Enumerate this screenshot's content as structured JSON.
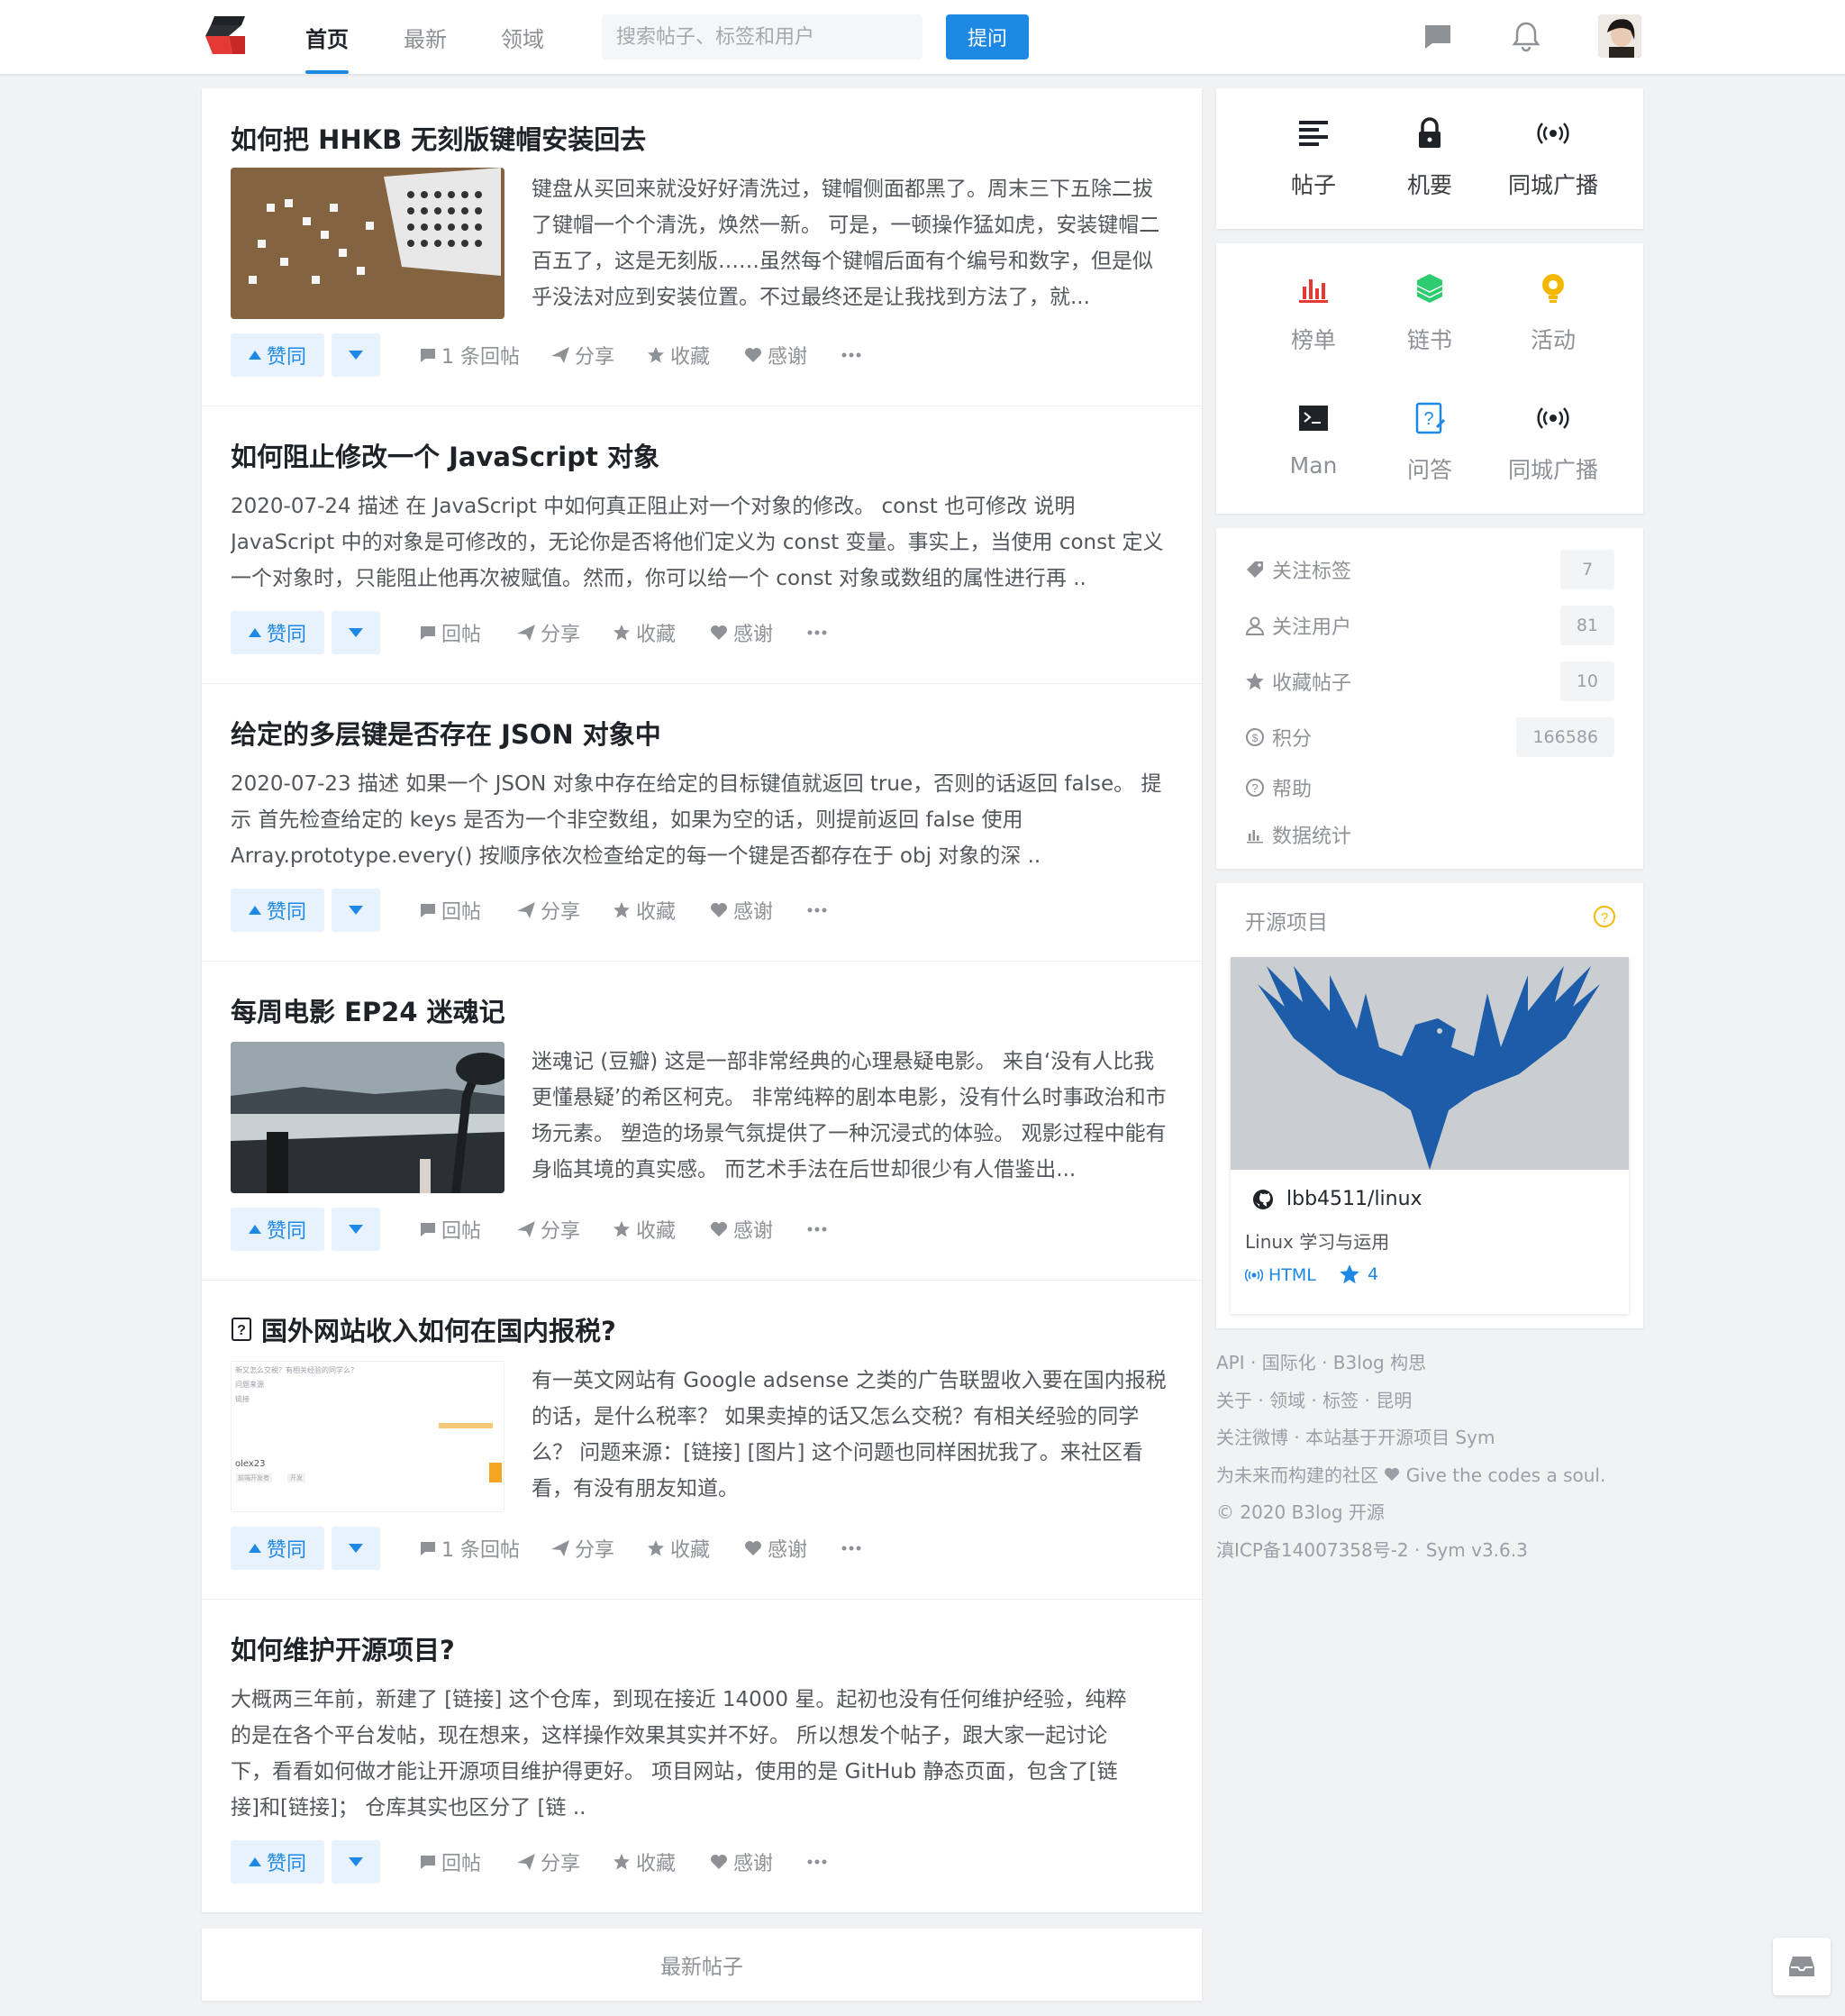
{
  "header": {
    "nav": [
      "首页",
      "最新",
      "领域"
    ],
    "search_placeholder": "搜索帖子、标签和用户",
    "ask_button": "提问"
  },
  "posts": [
    {
      "title": "如何把 HHKB 无刻版键帽安装回去",
      "excerpt": "键盘从买回来就没好好清洗过，键帽侧面都黑了。周末三下五除二拔了键帽一个个清洗，焕然一新。 可是，一顿操作猛如虎，安装键帽二百五了，这是无刻版……虽然每个键帽后面有个编号和数字，但是似乎没法对应到安装位置。不过最终还是让我找到方法了，就...",
      "has_thumb": true,
      "replies": "1 条回帖"
    },
    {
      "title": "如何阻止修改一个 JavaScript 对象",
      "excerpt": "2020-07-24 描述 在 JavaScript 中如何真正阻止对一个对象的修改。 const 也可修改 说明 JavaScript 中的对象是可修改的，无论你是否将他们定义为 const 变量。事实上，当使用 const 定义一个对象时，只能阻止他再次被赋值。然而，你可以给一个 const 对象或数组的属性进行再 ..",
      "has_thumb": false,
      "replies": "回帖"
    },
    {
      "title": "给定的多层键是否存在 JSON 对象中",
      "excerpt": "2020-07-23 描述 如果一个 JSON 对象中存在给定的目标键值就返回 true，否则的话返回 false。 提示 首先检查给定的 keys 是否为一个非空数组，如果为空的话，则提前返回 false 使用 Array.prototype.every() 按顺序依次检查给定的每一个键是否都存在于 obj 对象的深 ..",
      "has_thumb": false,
      "replies": "回帖"
    },
    {
      "title": "每周电影 EP24 迷魂记",
      "excerpt": "迷魂记 (豆瓣) 这是一部非常经典的心理悬疑电影。 来自‘没有人比我更懂悬疑’的希区柯克。 非常纯粹的剧本电影，没有什么时事政治和市场元素。 塑造的场景气氛提供了一种沉浸式的体验。 观影过程中能有身临其境的真实感。 而艺术手法在后世却很少有人借鉴出...",
      "has_thumb": true,
      "replies": "回帖"
    },
    {
      "title": "国外网站收入如何在国内报税?",
      "excerpt": "有一英文网站有 Google adsense 之类的广告联盟收入要在国内报税的话，是什么税率？ 如果卖掉的话又怎么交税？有相关经验的同学么？ 问题来源：[链接] [图片] 这个问题也同样困扰我了。来社区看看，有没有朋友知道。",
      "has_thumb": true,
      "replies": "1 条回帖"
    },
    {
      "title": "如何维护开源项目?",
      "excerpt": "大概两三年前，新建了 [链接] 这个仓库，到现在接近 14000 星。起初也没有任何维护经验，纯粹的是在各个平台发帖，现在想来，这样操作效果其实并不好。 所以想发个帖子，跟大家一起讨论下，看看如何做才能让开源项目维护得更好。 项目网站，使用的是 GitHub 静态页面，包含了[链接]和[链接]； 仓库其实也区分了 [链 ..",
      "has_thumb": false,
      "replies": "回帖"
    }
  ],
  "thumb_text": {
    "line1": "新又怎么交税？有相关经验的同学么？",
    "line2": "问题来源",
    "line3": "链接",
    "user": "olex23",
    "tags": [
      "前端开发者",
      "开发"
    ]
  },
  "post_actions": {
    "upvote": "赞同",
    "share": "分享",
    "collect": "收藏",
    "thank": "感谢"
  },
  "more_posts": "最新帖子",
  "sidebar": {
    "top_grid": [
      "帖子",
      "机要",
      "同城广播"
    ],
    "second_grid": [
      "榜单",
      "链书",
      "活动",
      "Man",
      "问答",
      "同城广播"
    ],
    "stats": [
      {
        "label": "关注标签",
        "value": "7"
      },
      {
        "label": "关注用户",
        "value": "81"
      },
      {
        "label": "收藏帖子",
        "value": "10"
      },
      {
        "label": "积分",
        "value": "166586"
      },
      {
        "label": "帮助",
        "value": ""
      },
      {
        "label": "数据统计",
        "value": ""
      }
    ],
    "open_source": {
      "title": "开源项目",
      "repo": "lbb4511/linux",
      "desc": "Linux 学习与运用",
      "lang": "HTML",
      "stars": "4"
    }
  },
  "footer": {
    "line1": [
      "API",
      "国际化",
      "B3log 构思"
    ],
    "line2": [
      "关于",
      "领域",
      "标签",
      "昆明"
    ],
    "line3": [
      "关注微博",
      "本站基于开源项目 Sym"
    ],
    "line4_a": "为未来而构建的社区",
    "line4_b": "Give the codes a soul.",
    "line5": "© 2020 B3log 开源",
    "line6": "滇ICP备14007358号-2 · Sym v3.6.3"
  },
  "colors": {
    "accent": "#1e88e5",
    "chart_red": "#e53935",
    "green": "#2ecc71",
    "yellow": "#f5b800"
  }
}
